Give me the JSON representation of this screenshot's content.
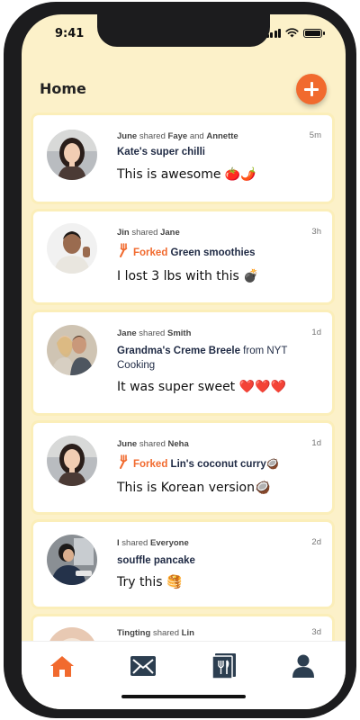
{
  "status_bar": {
    "time": "9:41"
  },
  "header": {
    "title": "Home"
  },
  "feed": [
    {
      "sharer": "June",
      "verb": "shared",
      "target1": "Faye",
      "joiner": "and",
      "target2": "Annette",
      "time": "5m",
      "recipe": "Kate's super chilli",
      "comment": "This is awesome 🍅🌶️",
      "avatar": "woman-smiling-photo"
    },
    {
      "sharer": "Jin",
      "verb": "shared",
      "target1": "Jane",
      "time": "3h",
      "forked": "Forked",
      "recipe": "Green smoothies",
      "comment": "I lost 3 lbs with this 💣",
      "avatar": "man-thumbs-up-photo"
    },
    {
      "sharer": "Jane",
      "verb": "shared",
      "target1": "Smith",
      "time": "1d",
      "recipe": "Grandma's Creme Breele",
      "source": "from NYT Cooking",
      "comment": "It was super sweet ❤️❤️❤️",
      "avatar": "couple-photo"
    },
    {
      "sharer": "June",
      "verb": "shared",
      "target1": "Neha",
      "time": "1d",
      "forked": "Forked",
      "recipe": "Lin's coconut curry🥥",
      "comment": "This is Korean version🥥",
      "avatar": "woman-smiling-photo"
    },
    {
      "sharer": "I",
      "verb": "shared",
      "target1": "Everyone",
      "time": "2d",
      "recipe": "souffle pancake",
      "comment": "Try this 🥞",
      "avatar": "woman-cooking-photo"
    },
    {
      "sharer": "Tingting",
      "verb": "shared",
      "target1": "Lin",
      "time": "3d",
      "avatar": "food-photo"
    }
  ],
  "tabbar": {
    "items": [
      {
        "name": "home",
        "icon": "home-icon",
        "active": true
      },
      {
        "name": "messages",
        "icon": "envelope-icon",
        "active": false
      },
      {
        "name": "recipes",
        "icon": "recipe-book-icon",
        "active": false
      },
      {
        "name": "profile",
        "icon": "person-icon",
        "active": false
      }
    ]
  },
  "colors": {
    "accent": "#f16a2e",
    "background": "#fcf1c9",
    "card": "#ffffff",
    "tab_inactive": "#2c3e50"
  }
}
